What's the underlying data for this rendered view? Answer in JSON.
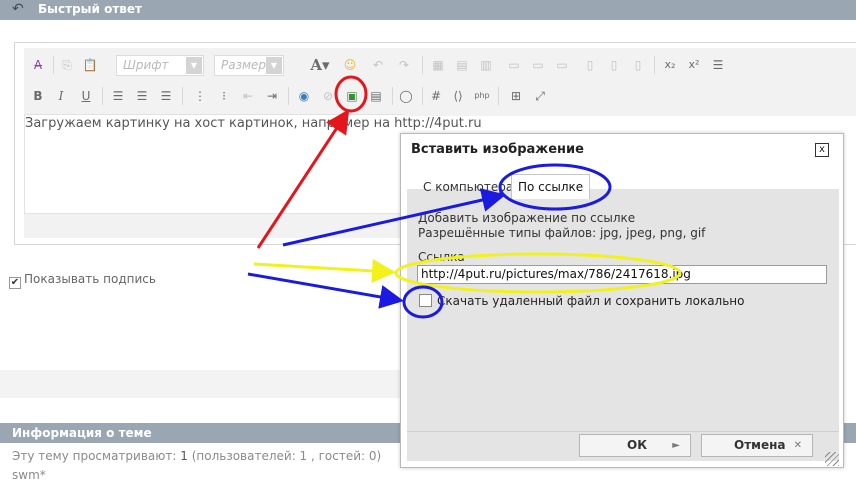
{
  "header": {
    "title": "Быстрый ответ"
  },
  "toolbar": {
    "font_label": "Шрифт",
    "size_label": "Размер"
  },
  "editor": {
    "text": "Загружаем картинку на хост картинок, например на http://4put.ru"
  },
  "signature": {
    "label": "Показывать подпись",
    "checked": true
  },
  "dialog": {
    "title": "Вставить изображение",
    "tabs": [
      "С компьютера",
      "По ссылке"
    ],
    "active_tab": "По ссылке",
    "info_line1": "Добавить изображение по ссылке",
    "info_line2": "Разрешённые типы файлов: jpg, jpeg, png, gif",
    "url_label": "Ссылка",
    "url_value": "http://4put.ru/pictures/max/786/2417618.jpg",
    "download_label": "Скачать удаленный файл и сохранить локально",
    "download_checked": false,
    "ok_label": "ОК",
    "cancel_label": "Отмена"
  },
  "topic_info": {
    "heading": "Информация о теме",
    "viewers_prefix": "Эту тему просматривают:",
    "viewers_count": "1",
    "viewers_detail": "(пользователей: 1 , гостей: 0)",
    "user": "swm*"
  },
  "annotation_colors": {
    "red": "#e4161b",
    "blue": "#1a1ae0",
    "yellow": "#f2f21a"
  }
}
